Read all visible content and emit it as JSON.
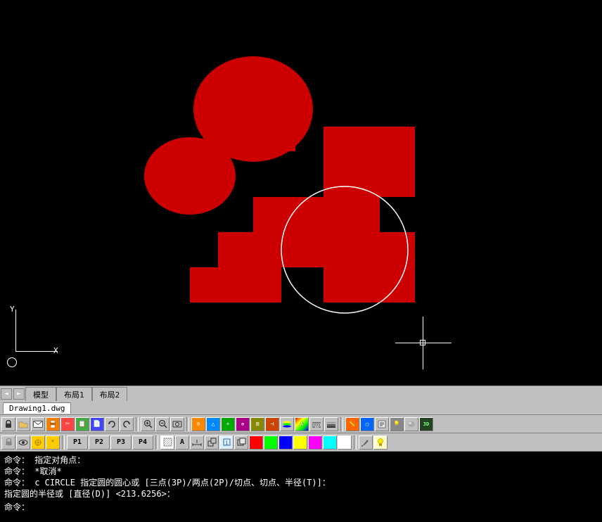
{
  "canvas": {
    "background": "#000000"
  },
  "tabs": {
    "scroll_left": "◄",
    "scroll_right": "►",
    "items": [
      {
        "label": "模型",
        "active": false
      },
      {
        "label": "布局1",
        "active": false
      },
      {
        "label": "布局2",
        "active": false
      }
    ]
  },
  "title": {
    "filename": "Drawing1.dwg"
  },
  "toolbar1": {
    "buttons": [
      "🔒",
      "📂",
      "✉",
      "🖨",
      "✂",
      "📋",
      "🗑",
      "↩",
      "↪",
      "🔍",
      "🔎",
      "🌍"
    ]
  },
  "toolbar2": {
    "buttons": [
      "P1",
      "P2",
      "P3",
      "P4"
    ]
  },
  "commands": [
    {
      "text": "命令：  指定对角点："
    },
    {
      "text": "命令：  *取消*"
    },
    {
      "text": "命令：  c CIRCLE 指定圆的圆心或 [三点(3P)/两点(2P)/切点、切点、半径(T)]："
    },
    {
      "text": "指定圆的半径或 [直径(D)] <213.6256>："
    }
  ],
  "command_prompt": "命令：",
  "axes": {
    "y_label": "Y",
    "x_label": "X"
  }
}
